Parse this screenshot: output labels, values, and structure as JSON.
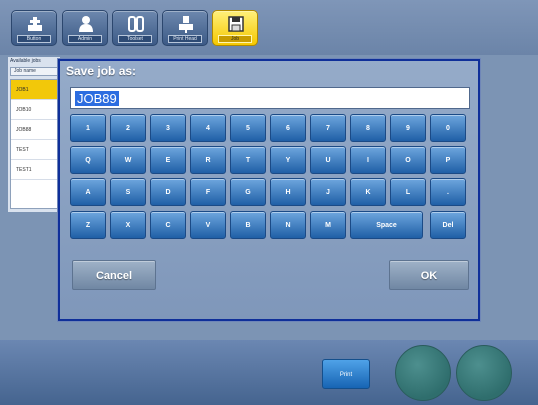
{
  "toolbar": {
    "buttons": [
      {
        "label": "Button",
        "icon": "tool-icon"
      },
      {
        "label": "Admin",
        "icon": "user-icon"
      },
      {
        "label": "Toolset",
        "icon": "sheet-icon"
      },
      {
        "label": "Print Head",
        "icon": "print-head-icon"
      },
      {
        "label": "Job",
        "icon": "save-icon"
      }
    ]
  },
  "jobs": {
    "title": "Available jobs",
    "column_header": "Job name",
    "items": [
      "JOB1",
      "JOB10",
      "JOB88",
      "TEST",
      "TEST1"
    ],
    "selected": "JOB1"
  },
  "dialog": {
    "title": "Save job as:",
    "input_value": "JOB89",
    "keys": {
      "row1": [
        "1",
        "2",
        "3",
        "4",
        "5",
        "6",
        "7",
        "8",
        "9",
        "0"
      ],
      "row2": [
        "Q",
        "W",
        "E",
        "R",
        "T",
        "Y",
        "U",
        "I",
        "O",
        "P"
      ],
      "row3": [
        "A",
        "S",
        "D",
        "F",
        "G",
        "H",
        "J",
        "K",
        "L",
        "."
      ],
      "row4": [
        "Z",
        "X",
        "C",
        "V",
        "B",
        "N",
        "M",
        "Space",
        "Del"
      ]
    },
    "cancel_label": "Cancel",
    "ok_label": "OK"
  },
  "bottom": {
    "print_label": "Print"
  },
  "colors": {
    "dialog_border": "#0f2f99",
    "key_blue": "#2a6bb2",
    "selected_yellow": "#f2c80a"
  }
}
